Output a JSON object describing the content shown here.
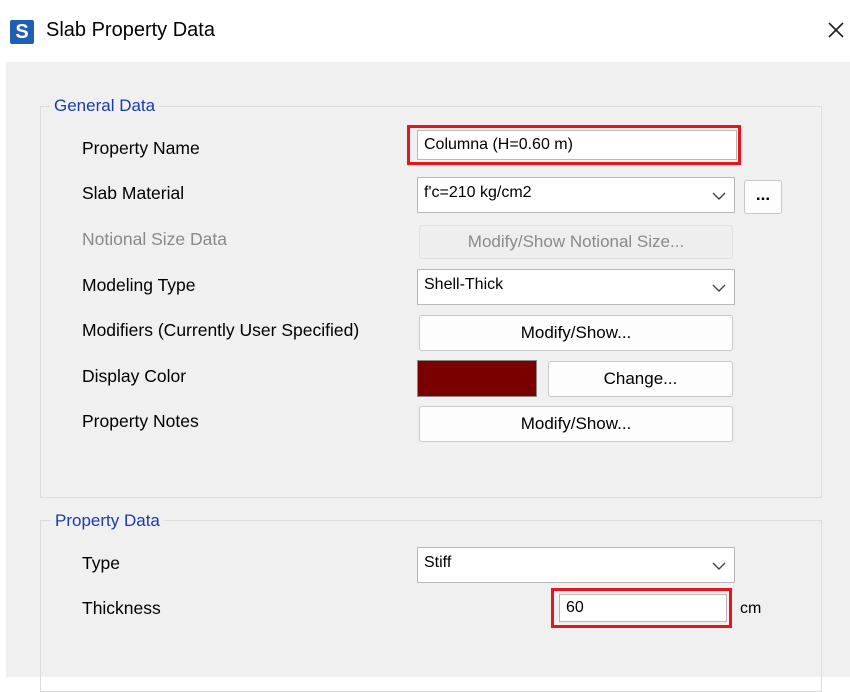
{
  "window": {
    "title": "Slab Property Data",
    "app_icon_letter": "S"
  },
  "general_data": {
    "legend": "General Data",
    "property_name": {
      "label": "Property Name",
      "value": "Columna (H=0.60 m)"
    },
    "slab_material": {
      "label": "Slab Material",
      "value": "f'c=210 kg/cm2",
      "more_button": "..."
    },
    "notional_size": {
      "label": "Notional Size Data",
      "button": "Modify/Show Notional Size..."
    },
    "modeling_type": {
      "label": "Modeling Type",
      "value": "Shell-Thick"
    },
    "modifiers": {
      "label": "Modifiers (Currently User Specified)",
      "button": "Modify/Show..."
    },
    "display_color": {
      "label": "Display Color",
      "color": "#7a0000",
      "button": "Change..."
    },
    "property_notes": {
      "label": "Property Notes",
      "button": "Modify/Show..."
    }
  },
  "property_data": {
    "legend": "Property Data",
    "type": {
      "label": "Type",
      "value": "Stiff"
    },
    "thickness": {
      "label": "Thickness",
      "value": "60",
      "unit": "cm"
    }
  },
  "colors": {
    "highlight": "#e8141c",
    "legend_text": "#1a3caa"
  }
}
